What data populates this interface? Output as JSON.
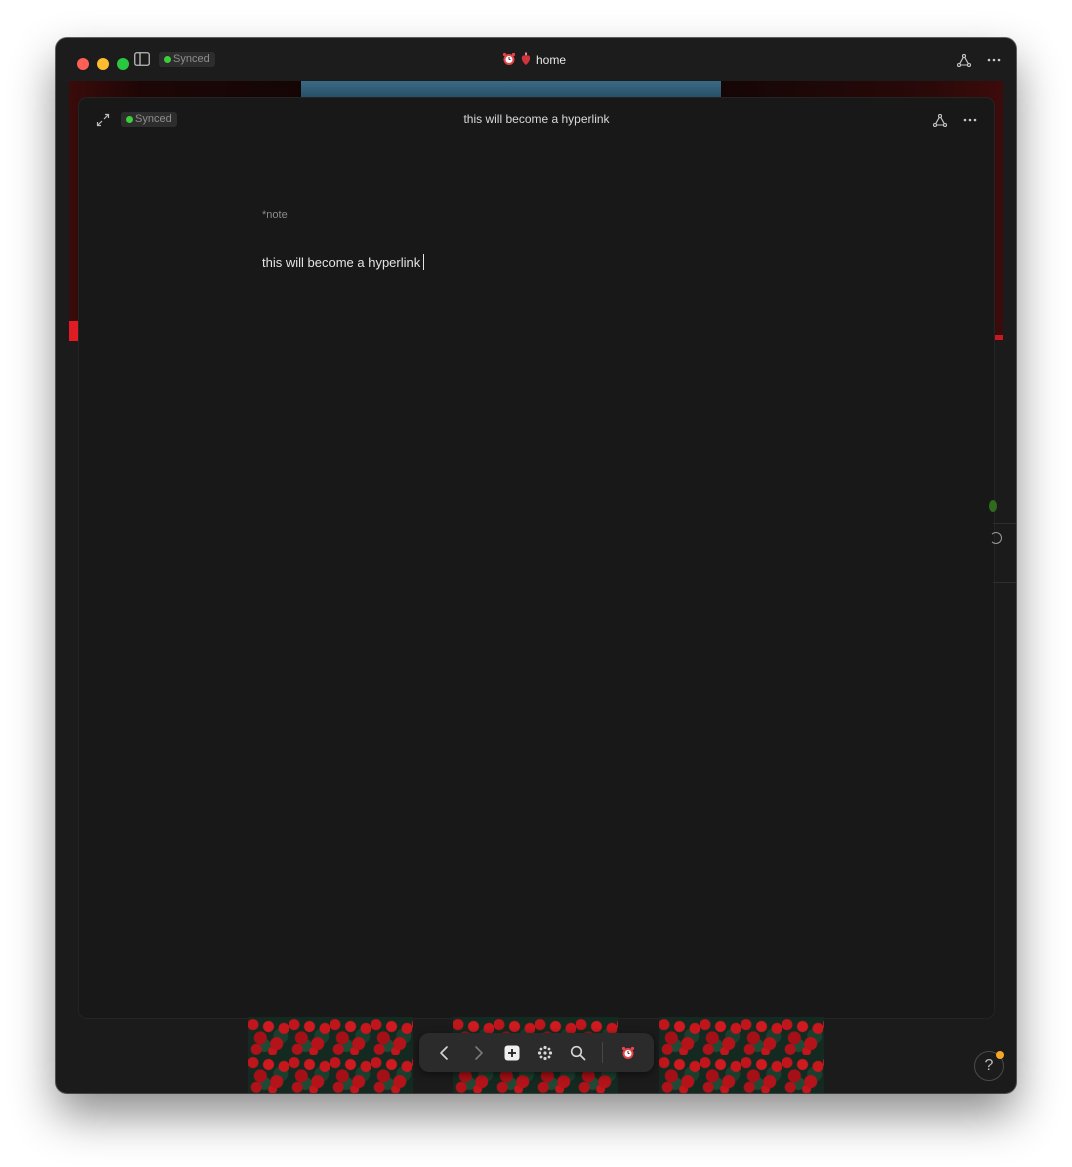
{
  "titlebar": {
    "sync_status": "Synced",
    "title": "home",
    "colors": {
      "close": "#fe5f57",
      "minimize": "#febc2e",
      "maximize": "#28c840",
      "sync_dot": "#3bcf3b"
    }
  },
  "note": {
    "sync_status": "Synced",
    "title": "this will become a hyperlink",
    "label": "*note",
    "body": "this will become a hyperlink"
  },
  "toolbar": {
    "items": [
      "chevron-left-icon",
      "chevron-right-icon",
      "new-page-icon",
      "apps-grid-icon",
      "search-icon",
      "workspace-icon"
    ]
  },
  "help": {
    "label": "?",
    "notification_color": "#f5a623"
  }
}
